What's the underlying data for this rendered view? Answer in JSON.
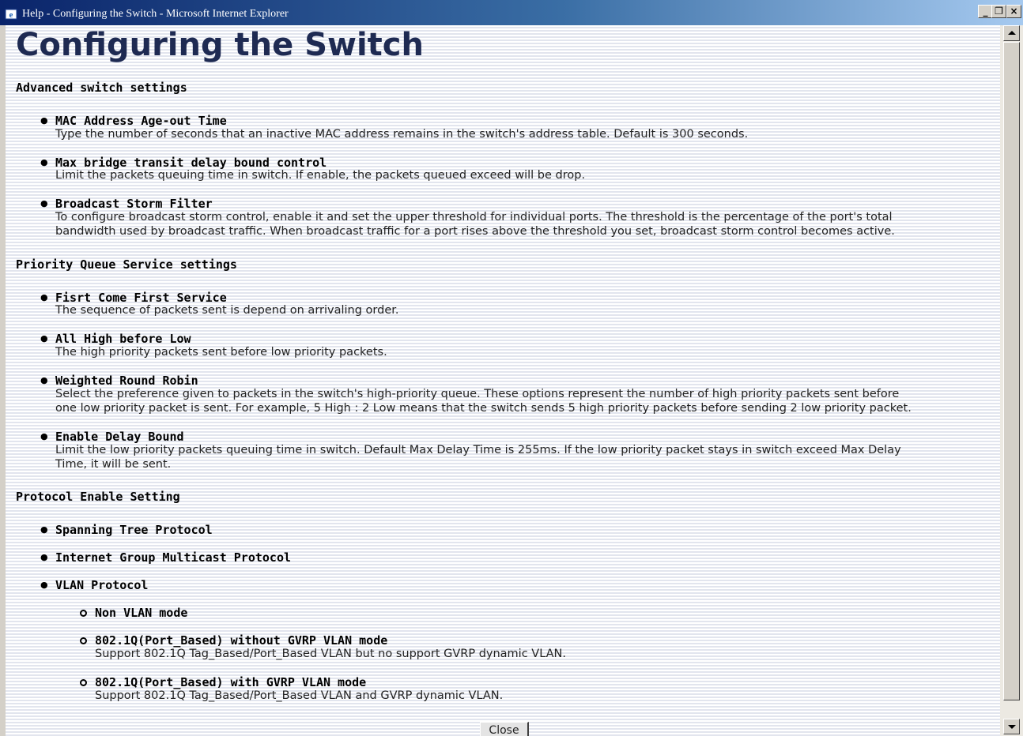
{
  "window": {
    "title": "Help - Configuring the Switch - Microsoft Internet Explorer",
    "minimize_label": "_",
    "maximize_label": "❐",
    "close_label": "×",
    "icon": "ie-icon"
  },
  "page": {
    "title": "Configuring the Switch"
  },
  "sections": [
    {
      "heading": "Advanced switch settings",
      "items": [
        {
          "title": "MAC Address Age-out Time",
          "desc": [
            "Type the number of seconds that an inactive MAC address remains in the switch's address table. Default is 300 seconds."
          ]
        },
        {
          "title": "Max bridge transit delay bound control",
          "desc": [
            "Limit the packets queuing time in switch. If enable, the packets queued exceed will be drop."
          ]
        },
        {
          "title": "Broadcast Storm Filter",
          "desc": [
            "To configure broadcast storm control, enable it and set the upper threshold for individual ports. The threshold is the percentage of the port's total",
            "bandwidth used by broadcast traffic. When broadcast traffic for a port rises above the threshold you set, broadcast storm control becomes active."
          ]
        }
      ]
    },
    {
      "heading": "Priority Queue Service settings",
      "items": [
        {
          "title": "Fisrt Come First Service",
          "desc": [
            "The sequence of packets sent is depend on arrivaling order."
          ]
        },
        {
          "title": "All High before Low",
          "desc": [
            "The high priority packets sent before low priority packets."
          ]
        },
        {
          "title": "Weighted Round Robin",
          "desc": [
            "Select the preference given to packets in the switch's high-priority queue. These options represent the number of high priority packets sent before",
            "one low priority packet is sent. For example, 5 High : 2 Low means that the switch sends 5 high priority packets before sending 2 low priority packet."
          ]
        },
        {
          "title": "Enable Delay Bound",
          "desc": [
            "Limit the low priority packets queuing time in switch. Default Max Delay Time is 255ms. If the low priority packet stays in switch exceed Max Delay",
            "Time, it will be sent."
          ]
        }
      ]
    },
    {
      "heading": "Protocol Enable Setting",
      "items": [
        {
          "title": "Spanning Tree Protocol"
        },
        {
          "title": "Internet Group Multicast Protocol"
        },
        {
          "title": "VLAN Protocol"
        }
      ],
      "sub_items": [
        {
          "title": "Non VLAN mode"
        },
        {
          "title": "802.1Q(Port_Based) without GVRP VLAN mode",
          "desc": [
            "Support 802.1Q Tag_Based/Port_Based VLAN but no support GVRP dynamic VLAN."
          ]
        },
        {
          "title": "802.1Q(Port_Based) with GVRP VLAN mode",
          "desc": [
            "Support 802.1Q Tag_Based/Port_Based VLAN and GVRP dynamic VLAN."
          ]
        }
      ]
    }
  ],
  "close_button_label": "Close",
  "colors": {
    "title_bar_start": "#0a246a",
    "title_bar_end": "#a6caf0",
    "page_title": "#1e2a52",
    "stripe_light": "#ffffff",
    "stripe_dark": "#e2e5ee"
  }
}
